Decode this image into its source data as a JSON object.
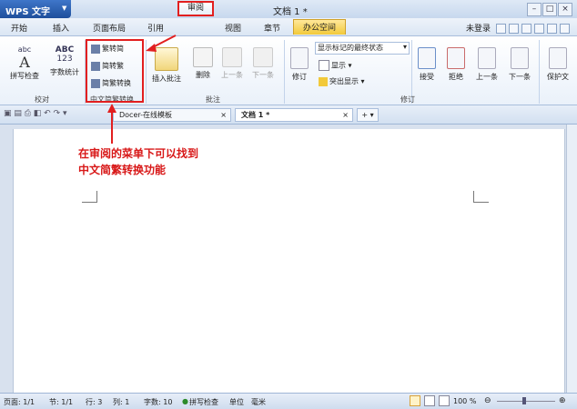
{
  "app": {
    "name": "WPS 文字",
    "doc_title": "文档 1 *"
  },
  "colors": {
    "highlight": "#e21f1f",
    "annotation": "#d81818",
    "office_tab": "#f2c93a"
  },
  "menu": {
    "tabs": [
      "开始",
      "插入",
      "页面布局",
      "引用",
      "审阅",
      "视图",
      "章节",
      "办公空间"
    ],
    "user": "未登录"
  },
  "ribbon": {
    "proof": {
      "spell": "拼写检查",
      "count": "字数统计",
      "label": "校对",
      "abc": "abc",
      "ABC": "ABC"
    },
    "convert": {
      "to_trad": "繁转简",
      "to_simp": "简转繁",
      "mix": "简繁转换",
      "label": "中文简繁转换"
    },
    "comment": {
      "insert": "插入批注",
      "delete": "删除",
      "prev": "上一条",
      "next": "下一条",
      "label": "批注"
    },
    "track": {
      "markup_select": "显示标记的最终状态",
      "show": "显示",
      "highlight_show": "突出显示",
      "revise": "修订",
      "accept": "接受",
      "reject": "拒绝",
      "prev": "上一条",
      "next": "下一条",
      "label": "修订"
    },
    "protect": {
      "label": "保护文"
    }
  },
  "doctabs": {
    "docer": "Docer-在线模板",
    "doc1": "文档 1 *"
  },
  "annotation": {
    "line1": "在审阅的菜单下可以找到",
    "line2": "中文简繁转换功能"
  },
  "status": {
    "page": "页面: 1/1",
    "section": "节: 1/1",
    "row": "行: 3",
    "col": "列: 1",
    "words": "字数: 10",
    "spell": "拼写检查",
    "unit_label": "单位",
    "unit": "毫米",
    "zoom": "100 %"
  }
}
